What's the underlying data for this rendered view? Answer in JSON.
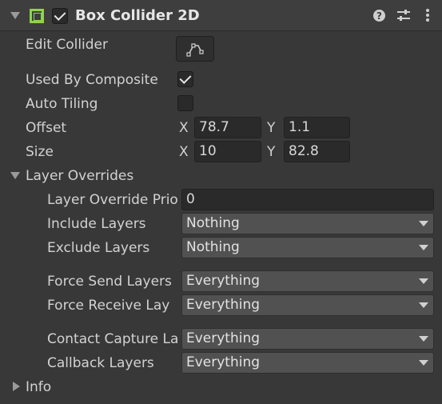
{
  "component": {
    "title": "Box Collider 2D",
    "enabled": true,
    "icon": "box-collider-2d-icon",
    "accent_color": "#8ed34e"
  },
  "header_icons": [
    "help-icon",
    "preset-sliders-icon",
    "more-menu-icon"
  ],
  "edit_collider": {
    "label": "Edit Collider",
    "icon": "edit-collider-shape-icon"
  },
  "used_by_composite": {
    "label": "Used By Composite",
    "checked": true
  },
  "auto_tiling": {
    "label": "Auto Tiling",
    "checked": false
  },
  "offset": {
    "label": "Offset",
    "x_label": "X",
    "x": "78.7",
    "y_label": "Y",
    "y": "1.1"
  },
  "size": {
    "label": "Size",
    "x_label": "X",
    "x": "10",
    "y_label": "Y",
    "y": "82.8"
  },
  "layer_overrides": {
    "label": "Layer Overrides",
    "expanded": true,
    "priority": {
      "label": "Layer Override Prio",
      "value": "0"
    },
    "include_layers": {
      "label": "Include Layers",
      "value": "Nothing"
    },
    "exclude_layers": {
      "label": "Exclude Layers",
      "value": "Nothing"
    },
    "force_send_layers": {
      "label": "Force Send Layers",
      "value": "Everything"
    },
    "force_receive_layers": {
      "label": "Force Receive Lay",
      "value": "Everything"
    },
    "contact_capture_layers": {
      "label": "Contact Capture La",
      "value": "Everything"
    },
    "callback_layers": {
      "label": "Callback Layers",
      "value": "Everything"
    }
  },
  "info": {
    "label": "Info",
    "expanded": false
  }
}
